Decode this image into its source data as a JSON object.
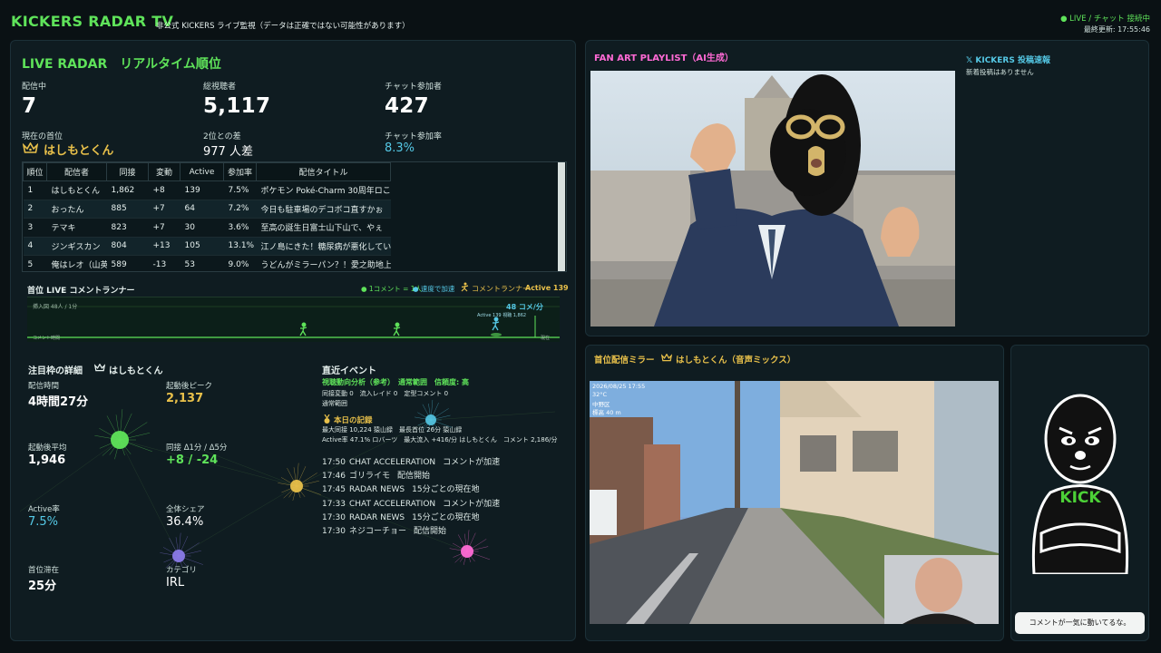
{
  "header": {
    "title": "KICKERS RADAR TV",
    "subtitle": "非公式 KICKERS ライブ監視（データは正確ではない可能性があります）",
    "status": "● LIVE / チャット 接続中",
    "last_updated": "最終更新: 17:55:46"
  },
  "radar": {
    "title": "LIVE RADAR　リアルタイム順位",
    "stats": [
      {
        "label": "配信中",
        "value": "7"
      },
      {
        "label": "総視聴者",
        "value": "5,117"
      },
      {
        "label": "チャット参加者",
        "value": "427"
      }
    ],
    "top_label": "現在の首位",
    "top_name": "はしもとくん",
    "gap_label": "2位との差",
    "gap_value": "977 人差",
    "rate_label": "チャット参加率",
    "rate_value": "8.3%",
    "table": {
      "headers": [
        "順位",
        "配信者",
        "同接",
        "変動",
        "Active",
        "参加率",
        "配信タイトル"
      ],
      "rows": [
        [
          "1",
          "はしもとくん",
          "1,862",
          "+8",
          "139",
          "7.5%",
          "ポケモン Poké-Charm 30周年ロこ"
        ],
        [
          "2",
          "おったん",
          "885",
          "+7",
          "64",
          "7.2%",
          "今日も駐車場のデコボコ直すかぉ"
        ],
        [
          "3",
          "テマキ",
          "823",
          "+7",
          "30",
          "3.6%",
          "至高の誕生日富士山下山で、やぇ"
        ],
        [
          "4",
          "ジンギスカン",
          "804",
          "+13",
          "105",
          "13.1%",
          "江ノ島にきた！糖尿病が悪化してい"
        ],
        [
          "5",
          "俺はレオ（山英",
          "589",
          "-13",
          "53",
          "9.0%",
          "うどんがミラーパン？！愛之助地上"
        ]
      ]
    }
  },
  "runner": {
    "title": "首位 LIVE コメントランナー",
    "legend1": "● 1コメント = 1人",
    "legend2": "● 速度で加速",
    "runner_label": "コメントランナー",
    "active": "Active 139",
    "rate": "48 コメ/分",
    "left_note": "挿入図 48人 / 1分",
    "small_note": "Active 139  視聴 1,862",
    "bottom_left": "コメント時間",
    "bottom_right": "現在"
  },
  "detail": {
    "title": "注目枠の詳細",
    "name": "はしもとくん",
    "stats": [
      {
        "label": "配信時間",
        "value": "4時間27分"
      },
      {
        "label": "起動後ピーク",
        "value": "2,137"
      },
      {
        "label": "起動後平均",
        "value": "1,946"
      },
      {
        "label": "同接 Δ1分 / Δ5分",
        "value": "+8 / -24"
      },
      {
        "label": "Active率",
        "value": "7.5%"
      },
      {
        "label": "全体シェア",
        "value": "36.4%"
      },
      {
        "label": "首位滞在",
        "value": "25分"
      },
      {
        "label": "カテゴリ",
        "value": "IRL"
      }
    ]
  },
  "events": {
    "title": "直近イベント",
    "analysis": "視聴動向分析（参考）　通常範囲　信頼度: 高",
    "analysis_line1": "同接変動 0　流入レイド 0　定型コメント 0",
    "analysis_line2": "通常範囲",
    "record_title": "本日の記録",
    "record_line1": "最大同接 10,224 猿山録　最長首位 26分 猿山録",
    "record_line2": "Active率 47.1% ロバーツ　最大流入 +416/分 はしもとくん　コメント 2,186/分",
    "list": [
      {
        "time": "17:50",
        "type": "CHAT ACCELERATION",
        "desc": "コメントが加速"
      },
      {
        "time": "17:46",
        "type": "ゴリライモ",
        "desc": "配信開始"
      },
      {
        "time": "17:45",
        "type": "RADAR NEWS",
        "desc": "15分ごとの現在地"
      },
      {
        "time": "17:33",
        "type": "CHAT ACCELERATION",
        "desc": "コメントが加速"
      },
      {
        "time": "17:30",
        "type": "RADAR NEWS",
        "desc": "15分ごとの現在地"
      },
      {
        "time": "17:30",
        "type": "ネジコーチョー",
        "desc": "配信開始"
      }
    ]
  },
  "fanart": {
    "title": "FAN ART PLAYLIST（AI生成）"
  },
  "x_feed": {
    "title": "𝕏 KICKERS 投稿速報",
    "empty": "新着投稿はありません"
  },
  "mirror": {
    "title": "首位配信ミラー",
    "name": "はしもとくん（音声ミックス）",
    "overlay_date": "2026/08/25 17:55",
    "overlay_temp": "32°C",
    "overlay_place": "中野区",
    "overlay_alt": "標高 40 m"
  },
  "mascot": {
    "shirt": "KICK",
    "bubble": "コメントが一気に動いてるな。"
  },
  "colors": {
    "accent_green": "#5fe35a",
    "gold": "#e8c04a",
    "cyan": "#55c9e6",
    "pink": "#ff6ad5"
  }
}
